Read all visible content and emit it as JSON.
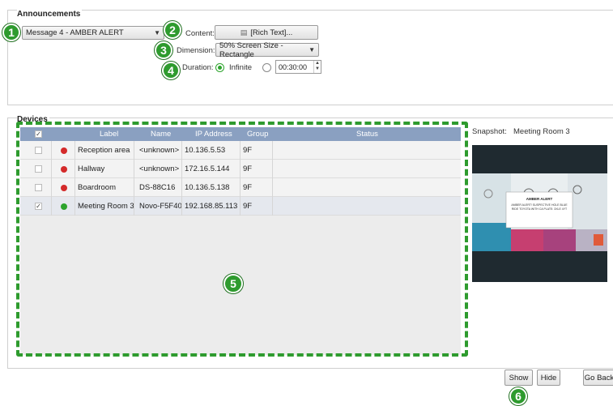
{
  "announcements": {
    "title": "Announcements",
    "message_select": "Message 4 - AMBER ALERT",
    "content_label": "Content:",
    "rich_text_button": "[Rich Text]...",
    "dimension_label": "Dimension:",
    "dimension_select": "50% Screen Size - Rectangle",
    "duration_label": "Duration:",
    "duration_infinite_label": "Infinite",
    "duration_time_value": "00:30:00",
    "duration_selected": "Infinite"
  },
  "devices": {
    "title": "Devices",
    "columns": [
      "Label",
      "Name",
      "IP Address",
      "Group",
      "Status"
    ],
    "rows": [
      {
        "label": "Reception area",
        "name": "<unknown>",
        "ip": "10.136.5.53",
        "group": "9F",
        "checked": false,
        "status_color": "#d42a2a"
      },
      {
        "label": "Hallway",
        "name": "<unknown>",
        "ip": "172.16.5.144",
        "group": "9F",
        "checked": false,
        "status_color": "#d42a2a"
      },
      {
        "label": "Boardroom",
        "name": "DS-88C16",
        "ip": "10.136.5.138",
        "group": "9F",
        "checked": false,
        "status_color": "#d42a2a"
      },
      {
        "label": "Meeting Room 3",
        "name": "Novo-F5F40",
        "ip": "192.168.85.113",
        "group": "9F",
        "checked": true,
        "status_color": "#2da42d"
      }
    ]
  },
  "snapshot": {
    "label": "Snapshot:",
    "device": "Meeting Room 3",
    "alert_title": "AMBER ALERT",
    "alert_text": "AMBER ALERT! SUSPECTIVE HOLE BLUE RIDE TOYOTA WITH CA PLATE: 3XLE 4YT"
  },
  "buttons": {
    "show": "Show",
    "hide": "Hide",
    "go_back": "Go Back"
  },
  "badges": [
    "1",
    "2",
    "3",
    "4",
    "5",
    "6"
  ],
  "colors": {
    "accent_green": "#2e9b2e",
    "header_blue": "#8aa0c1",
    "status_red": "#d42a2a",
    "status_green": "#2da42d"
  }
}
